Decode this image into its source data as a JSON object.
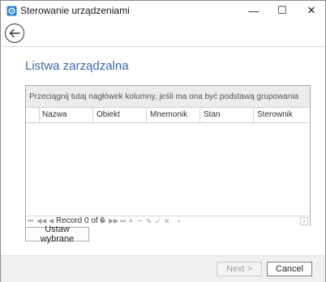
{
  "window": {
    "title": "Sterowanie urządzeniami",
    "minimize_glyph": "—",
    "maximize_glyph": "☐",
    "close_glyph": "✕"
  },
  "page": {
    "heading": "Listwa zarządzalna"
  },
  "grid": {
    "group_panel_text": "Przeciągnij tutaj nagłówek kolumny, jeśli ma ona być podstawą grupowania",
    "columns": [
      "Nazwa",
      "Obiekt",
      "Mnemonik",
      "Stan",
      "Sterownik"
    ],
    "navigator": {
      "record_text": "Record 0 of 0",
      "first_glyph": "⏮",
      "prev_page_glyph": "◀◀",
      "prev_glyph": "◀",
      "next_glyph": "▶",
      "next_page_glyph": "▶▶",
      "last_glyph": "⏭",
      "add_glyph": "+",
      "remove_glyph": "−",
      "edit_glyph": "✎",
      "accept_glyph": "✓",
      "cancel_glyph": "✕",
      "scroll_left_glyph": "‹",
      "scroll_right_glyph": "›"
    }
  },
  "actions": {
    "set_selected_label": "Ustaw wybrane",
    "next_label": "Next >",
    "cancel_label": "Cancel"
  },
  "colors": {
    "heading": "#3b6aa8",
    "footer_bg": "#f0f0f0",
    "group_panel_bg": "#ececec"
  },
  "icons": {
    "app": "device-control-app-icon",
    "back": "arrow-left-icon"
  }
}
